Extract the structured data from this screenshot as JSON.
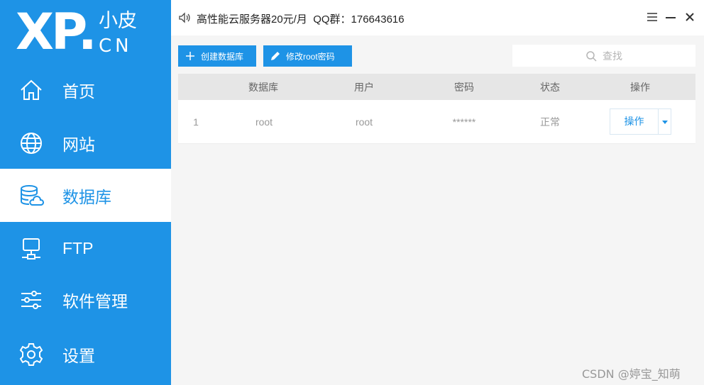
{
  "logo": {
    "mark": "XP",
    "dot": ".",
    "top_text": "小皮",
    "bottom_text": "CN"
  },
  "nav": [
    {
      "label": "首页",
      "icon": "home-icon"
    },
    {
      "label": "网站",
      "icon": "globe-icon"
    },
    {
      "label": "数据库",
      "icon": "database-icon",
      "active": true
    },
    {
      "label": "FTP",
      "icon": "monitor-icon"
    },
    {
      "label": "软件管理",
      "icon": "sliders-icon"
    },
    {
      "label": "设置",
      "icon": "gear-icon"
    }
  ],
  "titlebar": {
    "announcement": "高性能云服务器20元/月  QQ群：176643616"
  },
  "toolbar": {
    "create_label": "创建数据库",
    "change_pwd_label": "修改root密码"
  },
  "search": {
    "placeholder": "查找"
  },
  "table": {
    "headers": [
      "数据库",
      "用户",
      "密码",
      "状态",
      "操作"
    ],
    "rows": [
      {
        "index": "1",
        "database": "root",
        "user": "root",
        "password": "******",
        "status": "正常",
        "action": "操作"
      }
    ]
  },
  "watermark": "CSDN @婷宝_知萌",
  "colors": {
    "accent": "#1e93e6",
    "sidebar_bg": "#1e93e6",
    "header_bg": "#e6e6e6"
  }
}
